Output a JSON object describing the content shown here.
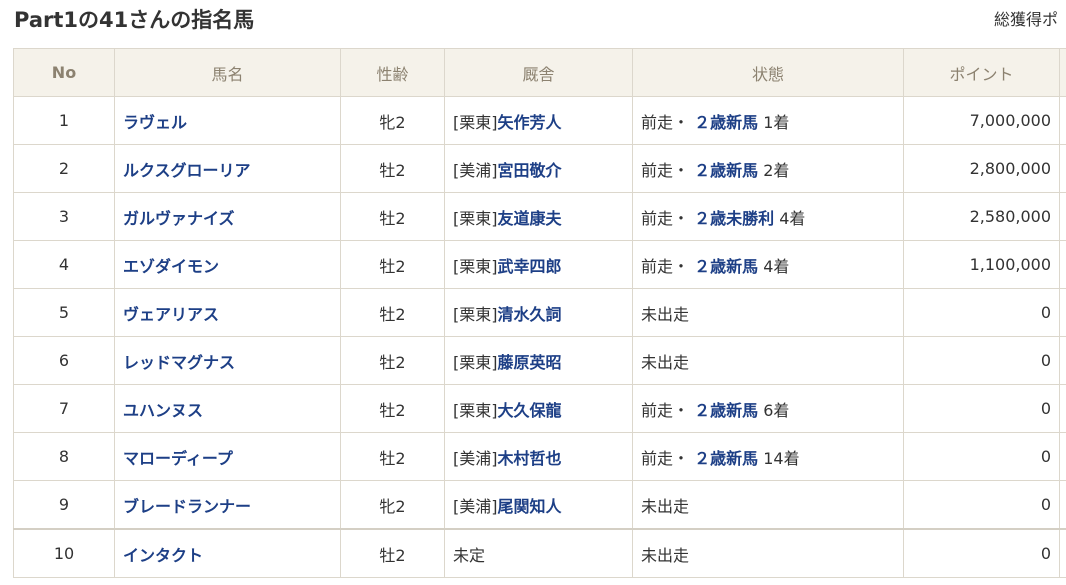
{
  "header": {
    "title": "Part1の41さんの指名馬",
    "total_label": "総獲得ポ"
  },
  "table": {
    "columns": [
      "No",
      "馬名",
      "性齢",
      "厩舎",
      "状態",
      "ポイント"
    ],
    "rows": [
      {
        "no": "1",
        "name": "ラヴェル",
        "sex_age": "牝2",
        "stable_region": "[栗東]",
        "trainer": "矢作芳人",
        "status_prefix": "前走・",
        "race": "２歳新馬",
        "place": "1着",
        "points": "7,000,000"
      },
      {
        "no": "2",
        "name": "ルクスグローリア",
        "sex_age": "牡2",
        "stable_region": "[美浦]",
        "trainer": "宮田敬介",
        "status_prefix": "前走・",
        "race": "２歳新馬",
        "place": "2着",
        "points": "2,800,000"
      },
      {
        "no": "3",
        "name": "ガルヴァナイズ",
        "sex_age": "牡2",
        "stable_region": "[栗東]",
        "trainer": "友道康夫",
        "status_prefix": "前走・",
        "race": "２歳未勝利",
        "place": "4着",
        "points": "2,580,000"
      },
      {
        "no": "4",
        "name": "エゾダイモン",
        "sex_age": "牡2",
        "stable_region": "[栗東]",
        "trainer": "武幸四郎",
        "status_prefix": "前走・",
        "race": "２歳新馬",
        "place": "4着",
        "points": "1,100,000"
      },
      {
        "no": "5",
        "name": "ヴェアリアス",
        "sex_age": "牡2",
        "stable_region": "[栗東]",
        "trainer": "清水久詞",
        "status_prefix": "未出走",
        "race": "",
        "place": "",
        "points": "0"
      },
      {
        "no": "6",
        "name": "レッドマグナス",
        "sex_age": "牡2",
        "stable_region": "[栗東]",
        "trainer": "藤原英昭",
        "status_prefix": "未出走",
        "race": "",
        "place": "",
        "points": "0"
      },
      {
        "no": "7",
        "name": "ユハンヌス",
        "sex_age": "牡2",
        "stable_region": "[栗東]",
        "trainer": "大久保龍",
        "status_prefix": "前走・",
        "race": "２歳新馬",
        "place": "6着",
        "points": "0"
      },
      {
        "no": "8",
        "name": "マローディープ",
        "sex_age": "牡2",
        "stable_region": "[美浦]",
        "trainer": "木村哲也",
        "status_prefix": "前走・",
        "race": "２歳新馬",
        "place": "14着",
        "points": "0"
      },
      {
        "no": "9",
        "name": "ブレードランナー",
        "sex_age": "牝2",
        "stable_region": "[美浦]",
        "trainer": "尾関知人",
        "status_prefix": "未出走",
        "race": "",
        "place": "",
        "points": "0"
      },
      {
        "no": "10",
        "name": "インタクト",
        "sex_age": "牡2",
        "stable_region": "未定",
        "trainer": "",
        "status_prefix": "未出走",
        "race": "",
        "place": "",
        "points": "0"
      }
    ]
  },
  "colors": {
    "link": "#1d3f86",
    "header_bg": "#f5f2ea",
    "header_text": "#8c8270",
    "border": "#dcd7cc"
  }
}
